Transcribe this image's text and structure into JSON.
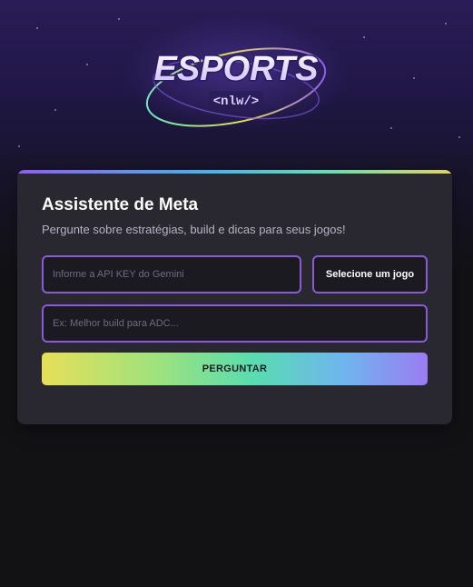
{
  "logo": {
    "title": "ESPORTS",
    "tag": "<nlw/>"
  },
  "card": {
    "title": "Assistente de Meta",
    "subtitle": "Pergunte sobre estratégias, build e dicas para seus jogos!"
  },
  "form": {
    "api_key_placeholder": "Informe a API KEY do Gemini",
    "game_select_label": "Selecione um jogo",
    "question_placeholder": "Ex: Melhor build para ADC...",
    "submit_label": "PERGUNTAR"
  },
  "colors": {
    "background": "#121214",
    "card": "#29272f",
    "field_border": "#8b5bd6",
    "accent_purple": "#8f5df2",
    "accent_yellow": "#e6df58"
  }
}
